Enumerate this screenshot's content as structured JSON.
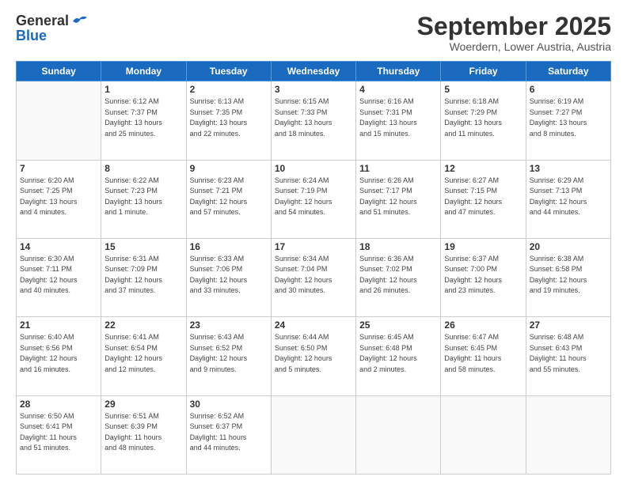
{
  "header": {
    "logo_general": "General",
    "logo_blue": "Blue",
    "month_title": "September 2025",
    "location": "Woerdern, Lower Austria, Austria"
  },
  "weekdays": [
    "Sunday",
    "Monday",
    "Tuesday",
    "Wednesday",
    "Thursday",
    "Friday",
    "Saturday"
  ],
  "weeks": [
    [
      {
        "day": "",
        "info": ""
      },
      {
        "day": "1",
        "info": "Sunrise: 6:12 AM\nSunset: 7:37 PM\nDaylight: 13 hours\nand 25 minutes."
      },
      {
        "day": "2",
        "info": "Sunrise: 6:13 AM\nSunset: 7:35 PM\nDaylight: 13 hours\nand 22 minutes."
      },
      {
        "day": "3",
        "info": "Sunrise: 6:15 AM\nSunset: 7:33 PM\nDaylight: 13 hours\nand 18 minutes."
      },
      {
        "day": "4",
        "info": "Sunrise: 6:16 AM\nSunset: 7:31 PM\nDaylight: 13 hours\nand 15 minutes."
      },
      {
        "day": "5",
        "info": "Sunrise: 6:18 AM\nSunset: 7:29 PM\nDaylight: 13 hours\nand 11 minutes."
      },
      {
        "day": "6",
        "info": "Sunrise: 6:19 AM\nSunset: 7:27 PM\nDaylight: 13 hours\nand 8 minutes."
      }
    ],
    [
      {
        "day": "7",
        "info": "Sunrise: 6:20 AM\nSunset: 7:25 PM\nDaylight: 13 hours\nand 4 minutes."
      },
      {
        "day": "8",
        "info": "Sunrise: 6:22 AM\nSunset: 7:23 PM\nDaylight: 13 hours\nand 1 minute."
      },
      {
        "day": "9",
        "info": "Sunrise: 6:23 AM\nSunset: 7:21 PM\nDaylight: 12 hours\nand 57 minutes."
      },
      {
        "day": "10",
        "info": "Sunrise: 6:24 AM\nSunset: 7:19 PM\nDaylight: 12 hours\nand 54 minutes."
      },
      {
        "day": "11",
        "info": "Sunrise: 6:26 AM\nSunset: 7:17 PM\nDaylight: 12 hours\nand 51 minutes."
      },
      {
        "day": "12",
        "info": "Sunrise: 6:27 AM\nSunset: 7:15 PM\nDaylight: 12 hours\nand 47 minutes."
      },
      {
        "day": "13",
        "info": "Sunrise: 6:29 AM\nSunset: 7:13 PM\nDaylight: 12 hours\nand 44 minutes."
      }
    ],
    [
      {
        "day": "14",
        "info": "Sunrise: 6:30 AM\nSunset: 7:11 PM\nDaylight: 12 hours\nand 40 minutes."
      },
      {
        "day": "15",
        "info": "Sunrise: 6:31 AM\nSunset: 7:09 PM\nDaylight: 12 hours\nand 37 minutes."
      },
      {
        "day": "16",
        "info": "Sunrise: 6:33 AM\nSunset: 7:06 PM\nDaylight: 12 hours\nand 33 minutes."
      },
      {
        "day": "17",
        "info": "Sunrise: 6:34 AM\nSunset: 7:04 PM\nDaylight: 12 hours\nand 30 minutes."
      },
      {
        "day": "18",
        "info": "Sunrise: 6:36 AM\nSunset: 7:02 PM\nDaylight: 12 hours\nand 26 minutes."
      },
      {
        "day": "19",
        "info": "Sunrise: 6:37 AM\nSunset: 7:00 PM\nDaylight: 12 hours\nand 23 minutes."
      },
      {
        "day": "20",
        "info": "Sunrise: 6:38 AM\nSunset: 6:58 PM\nDaylight: 12 hours\nand 19 minutes."
      }
    ],
    [
      {
        "day": "21",
        "info": "Sunrise: 6:40 AM\nSunset: 6:56 PM\nDaylight: 12 hours\nand 16 minutes."
      },
      {
        "day": "22",
        "info": "Sunrise: 6:41 AM\nSunset: 6:54 PM\nDaylight: 12 hours\nand 12 minutes."
      },
      {
        "day": "23",
        "info": "Sunrise: 6:43 AM\nSunset: 6:52 PM\nDaylight: 12 hours\nand 9 minutes."
      },
      {
        "day": "24",
        "info": "Sunrise: 6:44 AM\nSunset: 6:50 PM\nDaylight: 12 hours\nand 5 minutes."
      },
      {
        "day": "25",
        "info": "Sunrise: 6:45 AM\nSunset: 6:48 PM\nDaylight: 12 hours\nand 2 minutes."
      },
      {
        "day": "26",
        "info": "Sunrise: 6:47 AM\nSunset: 6:45 PM\nDaylight: 11 hours\nand 58 minutes."
      },
      {
        "day": "27",
        "info": "Sunrise: 6:48 AM\nSunset: 6:43 PM\nDaylight: 11 hours\nand 55 minutes."
      }
    ],
    [
      {
        "day": "28",
        "info": "Sunrise: 6:50 AM\nSunset: 6:41 PM\nDaylight: 11 hours\nand 51 minutes."
      },
      {
        "day": "29",
        "info": "Sunrise: 6:51 AM\nSunset: 6:39 PM\nDaylight: 11 hours\nand 48 minutes."
      },
      {
        "day": "30",
        "info": "Sunrise: 6:52 AM\nSunset: 6:37 PM\nDaylight: 11 hours\nand 44 minutes."
      },
      {
        "day": "",
        "info": ""
      },
      {
        "day": "",
        "info": ""
      },
      {
        "day": "",
        "info": ""
      },
      {
        "day": "",
        "info": ""
      }
    ]
  ]
}
